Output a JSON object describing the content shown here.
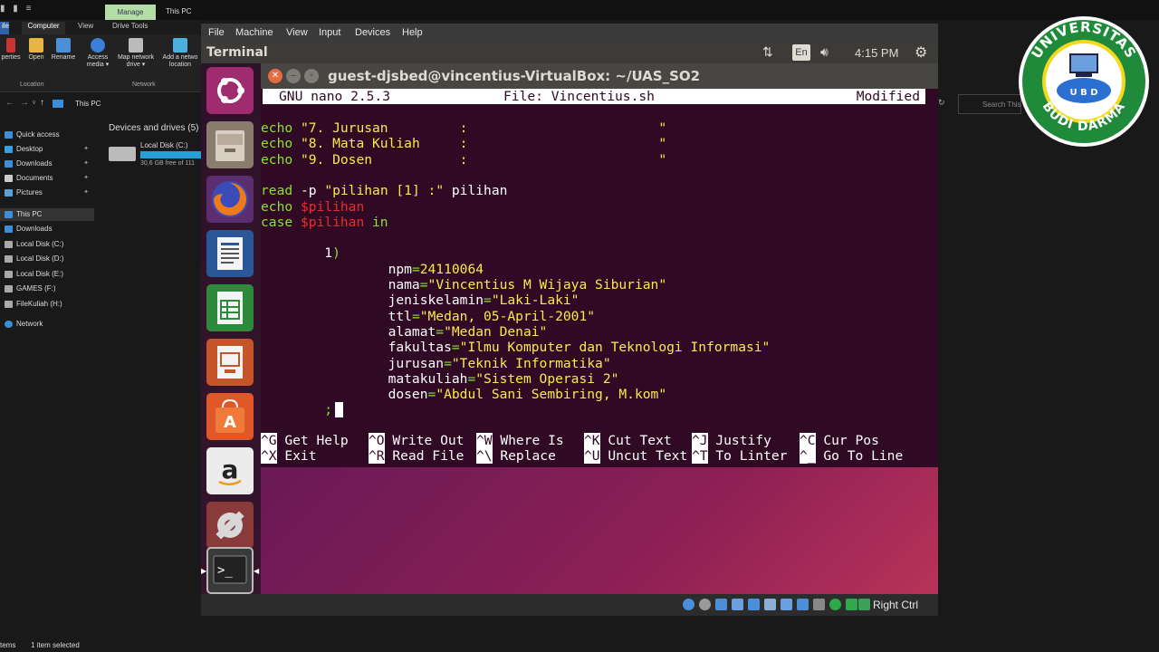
{
  "explorer": {
    "quick_access_toolbar": "▮ ▮ ≡",
    "manage_tab": "Manage",
    "window_title": "This PC",
    "ribbon_tabs": [
      "ile",
      "Computer",
      "View",
      "Drive Tools"
    ],
    "ribbon_buttons": [
      "perties",
      "Open",
      "Rename",
      "Access media ▾",
      "Map network drive ▾",
      "Add a netwo location"
    ],
    "ribbon_groups": [
      "Location",
      "Network"
    ],
    "address": "This PC",
    "search_placeholder": "Search This PC",
    "nav_items": [
      {
        "label": "Quick access",
        "pinned": false
      },
      {
        "label": "Desktop",
        "pinned": true
      },
      {
        "label": "Downloads",
        "pinned": true
      },
      {
        "label": "Documents",
        "pinned": true
      },
      {
        "label": "Pictures",
        "pinned": true
      },
      {
        "label": "This PC",
        "pinned": false
      },
      {
        "label": "Downloads",
        "pinned": false
      },
      {
        "label": "Local Disk (C:)",
        "pinned": false
      },
      {
        "label": "Local Disk (D:)",
        "pinned": false
      },
      {
        "label": "Local Disk (E:)",
        "pinned": false
      },
      {
        "label": "GAMES (F:)",
        "pinned": false
      },
      {
        "label": "FileKuliah (H:)",
        "pinned": false
      },
      {
        "label": "Network",
        "pinned": false
      }
    ],
    "devices_header": "Devices and drives (5)",
    "drive_c": {
      "name": "Local Disk (C:)",
      "free": "30,6 GB free of 111"
    },
    "status_items": "tems",
    "status_selected": "1 item selected"
  },
  "logo": {
    "top_text": "UNIVERSITAS",
    "bottom_text": "BUDI DARMA",
    "center_text": "U B D"
  },
  "vbox": {
    "menu": [
      "File",
      "Machine",
      "View",
      "Input",
      "Devices",
      "Help"
    ],
    "status_host_key": "Right Ctrl"
  },
  "ubuntu": {
    "topbar_title": "Terminal",
    "keyboard_layout": "En",
    "clock": "4:15 PM"
  },
  "terminal": {
    "title": "guest-djsbed@vincentius-VirtualBox: ~/UAS_SO2",
    "nano_version": "GNU nano 2.5.3",
    "nano_file": "File: Vincentius.sh",
    "nano_status": "Modified",
    "lines": {
      "l1_echo": "echo ",
      "l1_str": "\"7. Jurusan         :                        \"",
      "l2_echo": "echo ",
      "l2_str": "\"8. Mata Kuliah     :                        \"",
      "l3_echo": "echo ",
      "l3_str": "\"9. Dosen           :                        \"",
      "l5_read": "read",
      "l5_opt": " -p ",
      "l5_str": "\"pilihan [1] :\"",
      "l5_var": " pilihan",
      "l6_echo": "echo ",
      "l6_var": "$pilihan",
      "l7_case": "case ",
      "l7_var": "$pilihan",
      "l7_in": " in",
      "l9_num": "        1",
      "l9_paren": ")",
      "l10_key": "                npm",
      "l10_eq": "=",
      "l10_val": "24110064",
      "l11_key": "                nama",
      "l11_eq": "=",
      "l11_val": "\"Vincentius M Wijaya Siburian\"",
      "l12_key": "                jeniskelamin",
      "l12_eq": "=",
      "l12_val": "\"Laki-Laki\"",
      "l13_key": "                ttl",
      "l13_eq": "=",
      "l13_val": "\"Medan, 05-April-2001\"",
      "l14_key": "                alamat",
      "l14_eq": "=",
      "l14_val": "\"Medan Denai\"",
      "l15_key": "                fakultas",
      "l15_eq": "=",
      "l15_val": "\"Ilmu Komputer dan Teknologi Informasi\"",
      "l16_key": "                jurusan",
      "l16_eq": "=",
      "l16_val": "\"Teknik Informatika\"",
      "l17_key": "                matakuliah",
      "l17_eq": "=",
      "l17_val": "\"Sistem Operasi 2\"",
      "l18_key": "                dosen",
      "l18_eq": "=",
      "l18_val": "\"Abdul Sani Sembiring, M.kom\"",
      "l19": "        ;"
    },
    "shortcuts": [
      {
        "key": "^G",
        "label": " Get Help"
      },
      {
        "key": "^O",
        "label": " Write Out"
      },
      {
        "key": "^W",
        "label": " Where Is"
      },
      {
        "key": "^K",
        "label": " Cut Text"
      },
      {
        "key": "^J",
        "label": " Justify"
      },
      {
        "key": "^C",
        "label": " Cur Pos"
      },
      {
        "key": "^X",
        "label": " Exit"
      },
      {
        "key": "^R",
        "label": " Read File"
      },
      {
        "key": "^\\",
        "label": " Replace"
      },
      {
        "key": "^U",
        "label": " Uncut Text"
      },
      {
        "key": "^T",
        "label": " To Linter"
      },
      {
        "key": "^_",
        "label": " Go To Line"
      }
    ]
  },
  "colors": {
    "terminal_bg": "#300a24",
    "nano_keyword": "#8ae234",
    "nano_string": "#fce94f",
    "nano_variable": "#ef2929",
    "ubuntu_panel": "#3c3b37",
    "logo_green": "#1f8a3a"
  },
  "icons": [
    "ubuntu-dash-icon",
    "files-icon",
    "firefox-icon",
    "writer-icon",
    "calc-icon",
    "impress-icon",
    "software-center-icon",
    "amazon-icon",
    "settings-icon",
    "terminal-icon",
    "network-arrows-icon",
    "volume-icon",
    "gear-icon"
  ]
}
